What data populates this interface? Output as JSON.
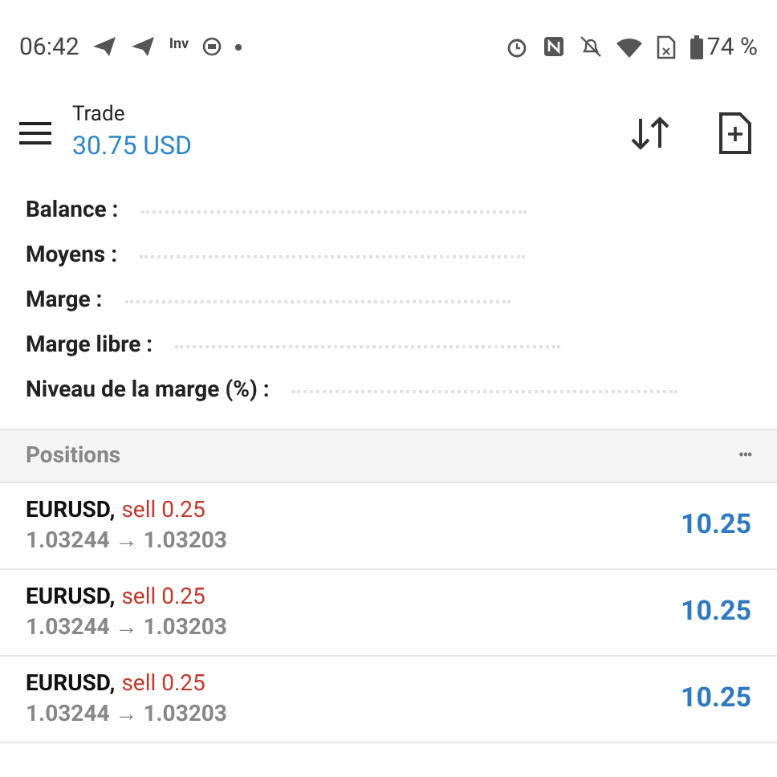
{
  "status_bar": {
    "time": "06:42",
    "app_badge": "Inv",
    "battery": "74 %"
  },
  "header": {
    "title": "Trade",
    "balance": "30.75 USD"
  },
  "summary": [
    {
      "label": "Balance :"
    },
    {
      "label": "Moyens :"
    },
    {
      "label": "Marge :"
    },
    {
      "label": "Marge libre :"
    },
    {
      "label": "Niveau de la marge (%) :"
    }
  ],
  "positions": {
    "title": "Positions",
    "more": "•••",
    "rows": [
      {
        "symbol": "EURUSD,",
        "side": "sell 0.25",
        "prices": "1.03244 → 1.03203",
        "profit": "10.25"
      },
      {
        "symbol": "EURUSD,",
        "side": "sell 0.25",
        "prices": "1.03244 → 1.03203",
        "profit": "10.25"
      },
      {
        "symbol": "EURUSD,",
        "side": "sell 0.25",
        "prices": "1.03244 → 1.03203",
        "profit": "10.25"
      }
    ]
  }
}
